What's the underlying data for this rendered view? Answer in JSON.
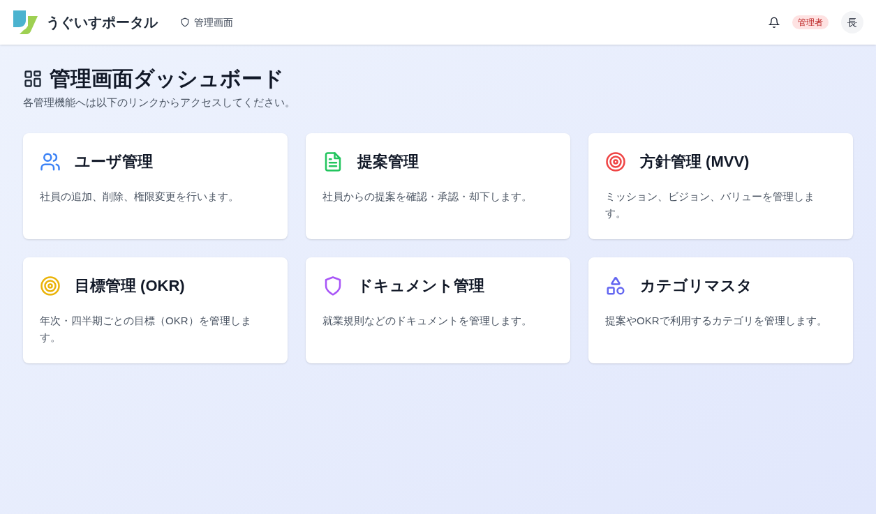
{
  "header": {
    "app_name": "うぐいすポータル",
    "nav_link": "管理画面",
    "role_badge": "管理者",
    "avatar": "長"
  },
  "page": {
    "title": "管理画面ダッシュボード",
    "subtitle": "各管理機能へは以下のリンクからアクセスしてください。"
  },
  "cards": [
    {
      "kind": "users",
      "color": "#3b82f6",
      "title": "ユーザ管理",
      "description": "社員の追加、削除、権限変更を行います。"
    },
    {
      "kind": "file",
      "color": "#22c55e",
      "title": "提案管理",
      "description": "社員からの提案を確認・承認・却下します。"
    },
    {
      "kind": "target",
      "color": "#ef4444",
      "title": "方針管理 (MVV)",
      "description": "ミッション、ビジョン、バリューを管理します。"
    },
    {
      "kind": "target",
      "color": "#eab308",
      "title": "目標管理 (OKR)",
      "description": "年次・四半期ごとの目標（OKR）を管理します。"
    },
    {
      "kind": "shield",
      "color": "#a855f7",
      "title": "ドキュメント管理",
      "description": "就業規則などのドキュメントを管理します。"
    },
    {
      "kind": "shapes",
      "color": "#6366f1",
      "title": "カテゴリマスタ",
      "description": "提案やOKRで利用するカテゴリを管理します。"
    }
  ]
}
